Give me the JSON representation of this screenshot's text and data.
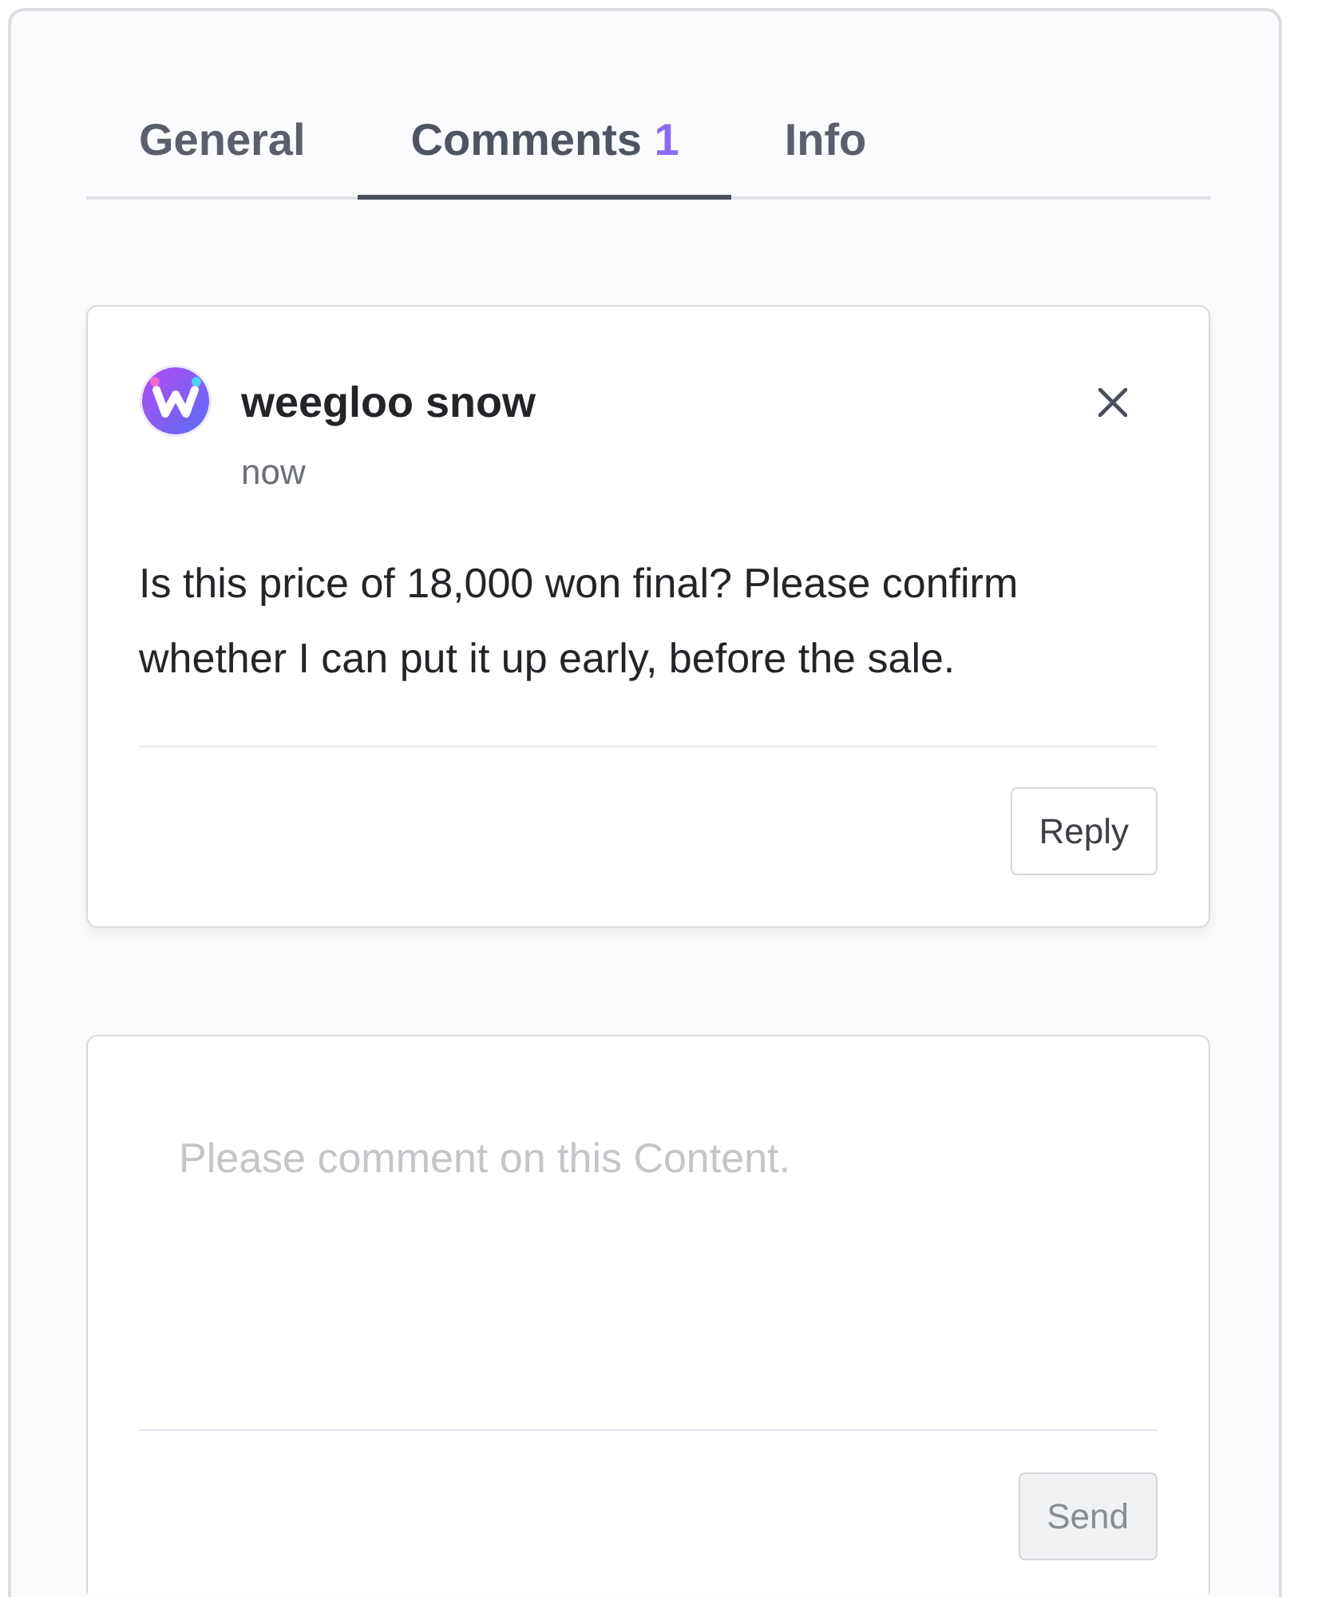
{
  "tabs": [
    {
      "label": "General",
      "selected": false
    },
    {
      "label": "Comments",
      "count": "1",
      "selected": true
    },
    {
      "label": "Info",
      "selected": false
    }
  ],
  "comments": [
    {
      "author": "weegloo snow",
      "time": "now",
      "text": "Is this price of 18,000 won final? Please confirm whether I can put it up early, before the sale.",
      "reply_button": "Reply"
    }
  ],
  "comment_form": {
    "placeholder": "Please comment on this Content.",
    "send_button": "Send",
    "send_disabled": true
  }
}
